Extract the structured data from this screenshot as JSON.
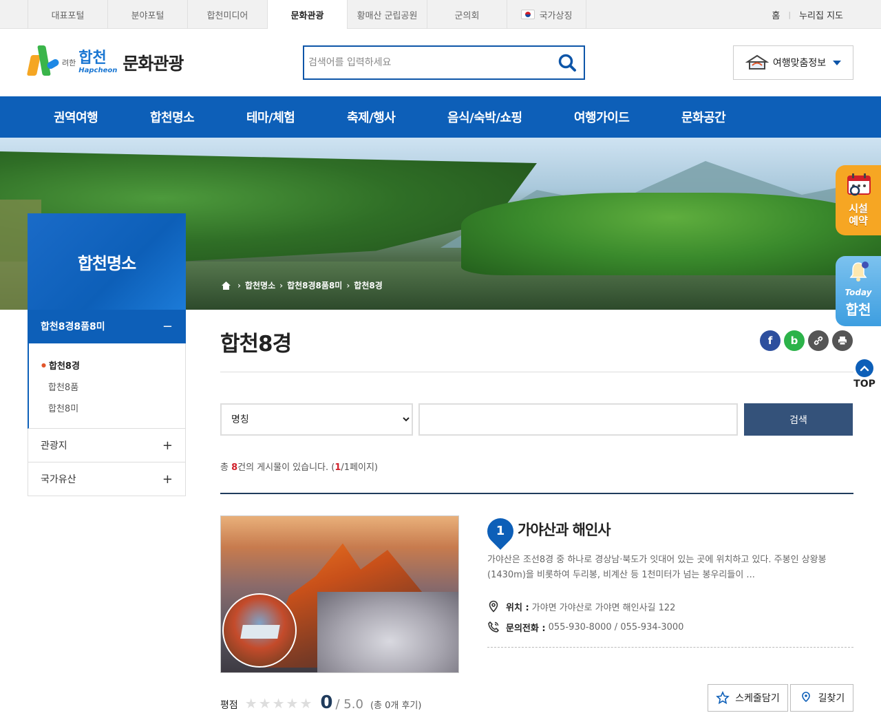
{
  "topbar": {
    "tabs": [
      "대표포털",
      "분야포털",
      "합천미디어",
      "문화관광",
      "황매산 군립공원",
      "군의회",
      "국가상징"
    ],
    "active_tab": "문화관광",
    "home": "홈",
    "sitemap": "누리집 지도"
  },
  "header": {
    "logo_small": "K",
    "logo_hap_kr": "합천",
    "logo_hap_en": "Hapcheon",
    "logo_prefix": "려한",
    "logo_title": "문화관광",
    "search_placeholder": "검색어를 입력하세요",
    "travel_info": "여행맞춤정보"
  },
  "gnb": [
    "권역여행",
    "합천명소",
    "테마/체험",
    "축제/행사",
    "음식/숙박/쇼핑",
    "여행가이드",
    "문화공간"
  ],
  "breadcrumb": [
    "합천명소",
    "합천8경8품8미",
    "합천8경"
  ],
  "lnb": {
    "title": "합천명소",
    "active_group": "합천8경8품8미",
    "active_group_toggle": "−",
    "sub_items": [
      "합천8경",
      "합천8품",
      "합천8미"
    ],
    "active_sub": "합천8경",
    "groups": [
      {
        "label": "관광지",
        "toggle": "+"
      },
      {
        "label": "국가유산",
        "toggle": "+"
      }
    ]
  },
  "content": {
    "page_title": "합천8경",
    "share": [
      {
        "icon": "facebook-icon",
        "glyph": "f",
        "color": "#2d4f9e"
      },
      {
        "icon": "band-icon",
        "glyph": "b",
        "color": "#2cb34a"
      },
      {
        "icon": "link-icon",
        "glyph": "🔗",
        "color": "#555555"
      },
      {
        "icon": "print-icon",
        "glyph": "⎙",
        "color": "#555555"
      }
    ],
    "filter": {
      "select_value": "명칭",
      "search_button": "검색"
    },
    "count": {
      "prefix": "총 ",
      "total": "8",
      "middle": "건의 게시물이 있습니다. (",
      "page": "1",
      "suffix": "/1페이지)"
    }
  },
  "item": {
    "number": "1",
    "name": "가야산과 해인사",
    "description": "가야산은 조선8경 중 하나로 경상남·북도가 잇대어 있는 곳에 위치하고 있다. 주봉인 상왕봉(1430m)을 비롯하여 두리봉, 비계산 등 1천미터가 넘는 봉우리들이 ...",
    "location_label": "위치 :",
    "location_value": "가야면 가야산로 가야면 해인사길 122",
    "phone_label": "문의전화 :",
    "phone_value": "055-930-8000 / 055-934-3000",
    "rating_label": "평점",
    "rating_stars": "★★★★★",
    "rating_score": "0",
    "rating_max": "/ 5.0",
    "rating_count": "(총 0개 후기)",
    "schedule_button": "스케줄담기",
    "directions_button": "길찾기"
  },
  "floating": {
    "reserve_line1": "시설",
    "reserve_line2": "예약",
    "today": "Today",
    "hapcheon": "합천",
    "top": "TOP"
  },
  "colors": {
    "primary": "#0d5fb8",
    "dark_navy": "#34527a",
    "accent_orange": "#f6a623",
    "highlight_red": "#d0202a"
  }
}
